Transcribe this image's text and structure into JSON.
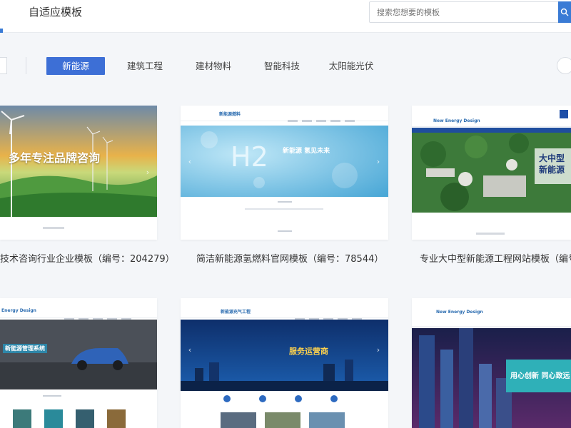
{
  "header": {
    "title": "自适应模板",
    "search_placeholder": "搜索您想要的模板"
  },
  "tabs": [
    {
      "label": "新能源",
      "active": true
    },
    {
      "label": "建筑工程",
      "active": false
    },
    {
      "label": "建材物料",
      "active": false
    },
    {
      "label": "智能科技",
      "active": false
    },
    {
      "label": "太阳能光伏",
      "active": false
    }
  ],
  "cards": [
    {
      "caption": "技术咨询行业企业模板（编号：204279）",
      "banner": "多年专注品牌咨询"
    },
    {
      "caption": "简洁新能源氢燃料官网模板（编号：78544）",
      "logo": "新能源燃料",
      "banner_big": "H2",
      "banner": "新能源 氢见未来"
    },
    {
      "caption": "专业大中型新能源工程网站模板（编号：",
      "logo": "New Energy Design",
      "banner": "大中型 新能源工"
    },
    {
      "logo": "Energy Design",
      "banner": "新能源管理系统"
    },
    {
      "logo": "新能源充气工程",
      "banner": "服务运营商"
    },
    {
      "logo": "New Energy Design",
      "banner": "用心创新 同心致远"
    }
  ],
  "colors": {
    "accent": "#3d6fd6",
    "header_bg": "#ffffff",
    "page_bg": "#f4f6f9"
  }
}
